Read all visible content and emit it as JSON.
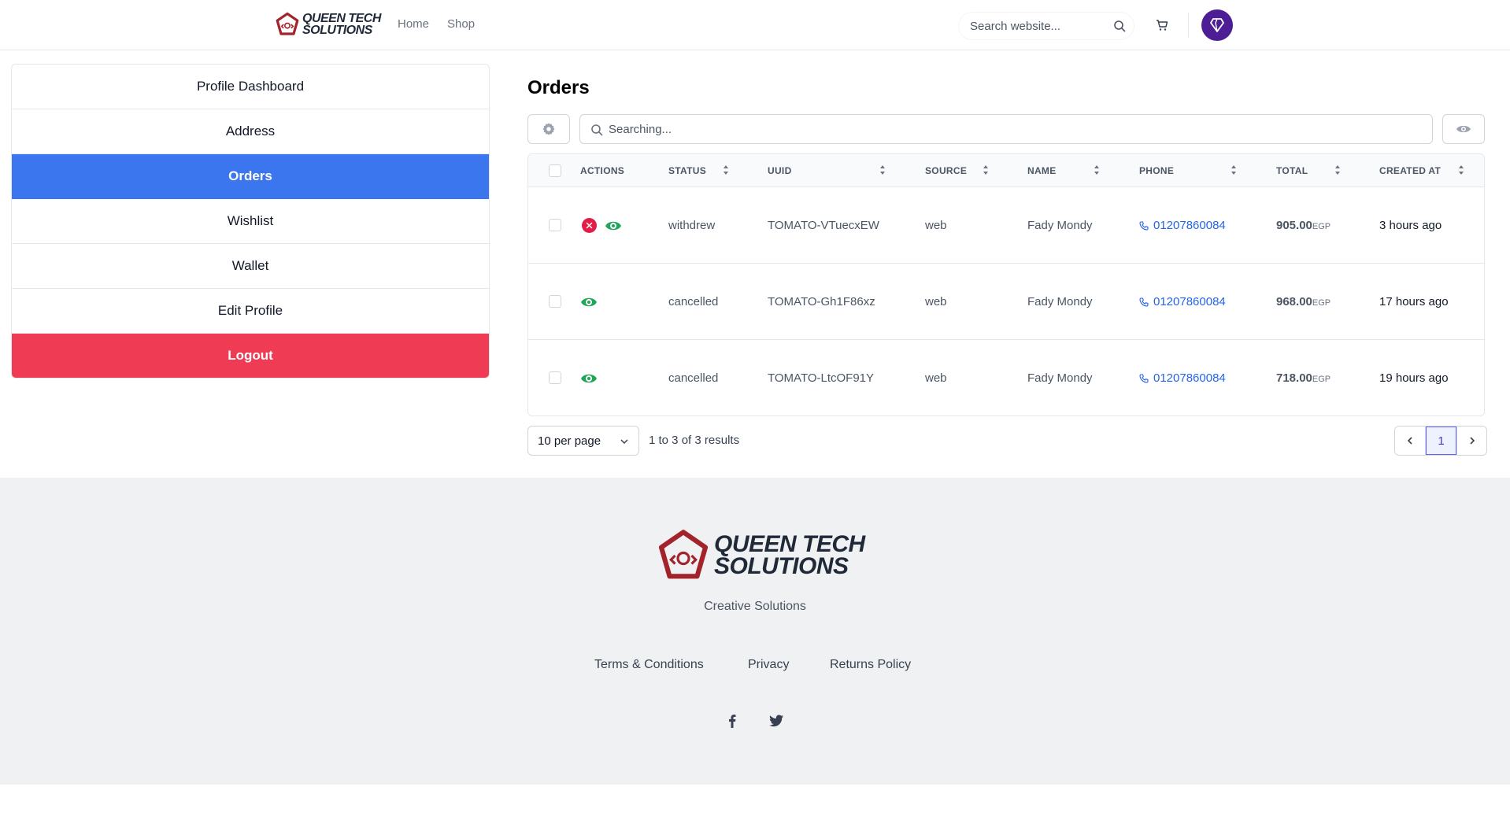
{
  "header": {
    "brand_line1": "QUEEN TECH",
    "brand_line2": "SOLUTIONS",
    "nav": [
      "Home",
      "Shop"
    ],
    "search_placeholder": "Search website..."
  },
  "sidebar": {
    "items": [
      {
        "label": "Profile Dashboard"
      },
      {
        "label": "Address"
      },
      {
        "label": "Orders"
      },
      {
        "label": "Wishlist"
      },
      {
        "label": "Wallet"
      },
      {
        "label": "Edit Profile"
      },
      {
        "label": "Logout"
      }
    ]
  },
  "orders": {
    "title": "Orders",
    "search_placeholder": "Searching...",
    "columns": [
      "ACTIONS",
      "STATUS",
      "UUID",
      "SOURCE",
      "NAME",
      "PHONE",
      "TOTAL",
      "CREATED AT"
    ],
    "rows": [
      {
        "status": "withdrew",
        "uuid": "TOMATO-VTuecxEW",
        "source": "web",
        "name": "Fady Mondy",
        "phone": "01207860084",
        "total": "905.00",
        "currency": "EGP",
        "created": "3 hours ago"
      },
      {
        "status": "cancelled",
        "uuid": "TOMATO-Gh1F86xz",
        "source": "web",
        "name": "Fady Mondy",
        "phone": "01207860084",
        "total": "968.00",
        "currency": "EGP",
        "created": "17 hours ago"
      },
      {
        "status": "cancelled",
        "uuid": "TOMATO-LtcOF91Y",
        "source": "web",
        "name": "Fady Mondy",
        "phone": "01207860084",
        "total": "718.00",
        "currency": "EGP",
        "created": "19 hours ago"
      }
    ],
    "per_page": "10 per page",
    "results": "1 to 3 of 3 results",
    "current_page": "1"
  },
  "footer": {
    "brand_line1": "QUEEN TECH",
    "brand_line2": "SOLUTIONS",
    "tagline": "Creative Solutions",
    "links": [
      "Terms & Conditions",
      "Privacy",
      "Returns Policy"
    ]
  },
  "colors": {
    "primary": "#3b76ee",
    "logout": "#f03b55",
    "avatar": "#4c1d95",
    "link": "#2563eb",
    "eye_green": "#22a559",
    "logo_red": "#a3232b"
  }
}
